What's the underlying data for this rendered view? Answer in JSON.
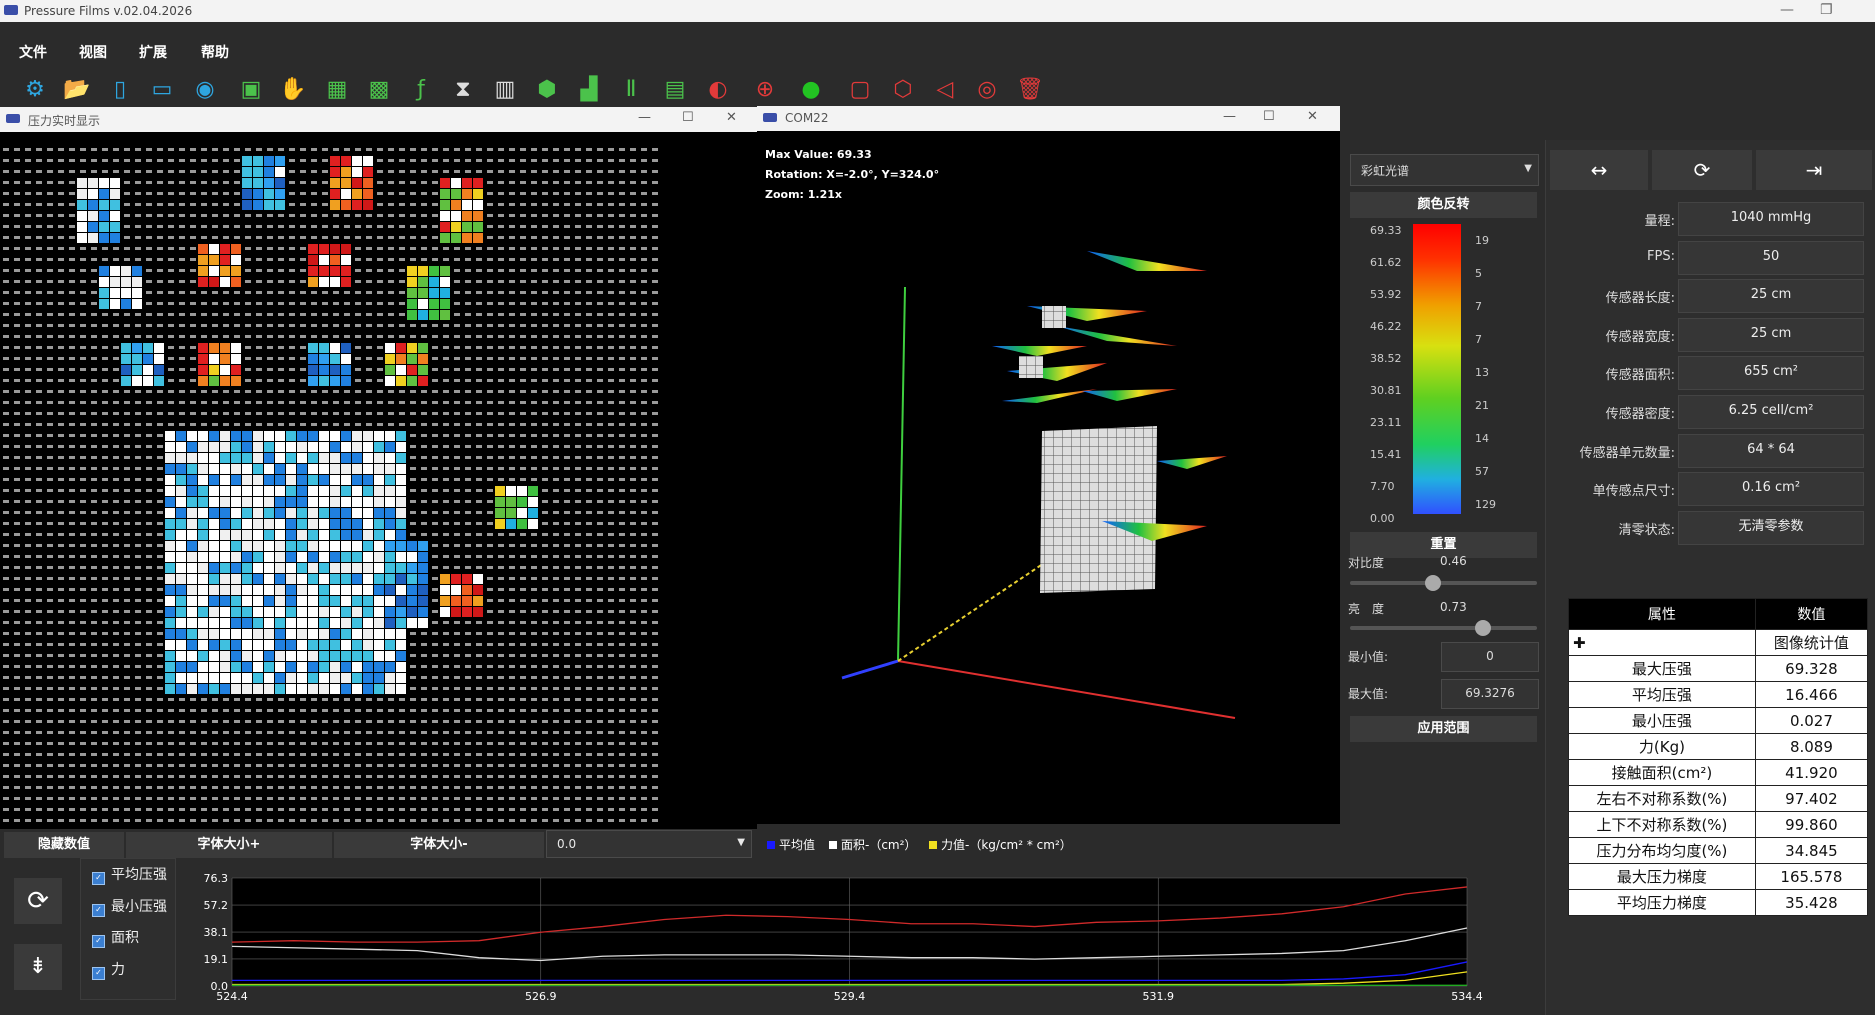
{
  "app": {
    "title": "Pressure Films v.02.04.2026"
  },
  "menu": [
    "文件",
    "视图",
    "扩展",
    "帮助"
  ],
  "toolbar": [
    {
      "icon": "tools-icon",
      "glyph": "⚙",
      "color": "#2ea6e0"
    },
    {
      "icon": "folder-open-icon",
      "glyph": "📂",
      "color": "#2ea6e0"
    },
    {
      "icon": "document-icon",
      "glyph": "▯",
      "color": "#2ea6e0"
    },
    {
      "icon": "monitor-icon",
      "glyph": "▭",
      "color": "#2ea6e0"
    },
    {
      "icon": "camera-icon",
      "glyph": "◉",
      "color": "#2ea6e0"
    },
    {
      "icon": "calibrate-icon",
      "glyph": "▣",
      "color": "#4bc24b"
    },
    {
      "icon": "hand-icon",
      "glyph": "✋",
      "color": "#4bc24b"
    },
    {
      "icon": "grid-icon",
      "glyph": "▦",
      "color": "#4bc24b"
    },
    {
      "icon": "grid-dense-icon",
      "glyph": "▩",
      "color": "#4bc24b"
    },
    {
      "icon": "function-icon",
      "glyph": "ƒ",
      "color": "#4bc24b"
    },
    {
      "icon": "hourglass-icon",
      "glyph": "⧗",
      "color": "#dddddd"
    },
    {
      "icon": "book-icon",
      "glyph": "▥",
      "color": "#dddddd"
    },
    {
      "icon": "cube-icon",
      "glyph": "⬢",
      "color": "#4bc24b"
    },
    {
      "icon": "chart-icon",
      "glyph": "▟",
      "color": "#4bc24b"
    },
    {
      "icon": "ruler-icon",
      "glyph": "Ⅱ",
      "color": "#4bc24b"
    },
    {
      "icon": "report-icon",
      "glyph": "▤",
      "color": "#4bc24b"
    },
    {
      "icon": "target-icon",
      "glyph": "◐",
      "color": "#e23a3a"
    },
    {
      "icon": "globe-icon",
      "glyph": "⊕",
      "color": "#e23a3a"
    },
    {
      "icon": "record-icon",
      "glyph": "●",
      "color": "#22c322"
    },
    {
      "icon": "crop-icon",
      "glyph": "▢",
      "color": "#e23a3a"
    },
    {
      "icon": "polygon-icon",
      "glyph": "⬡",
      "color": "#e23a3a"
    },
    {
      "icon": "lasso-icon",
      "glyph": "◁",
      "color": "#e23a3a"
    },
    {
      "icon": "eye-icon",
      "glyph": "◎",
      "color": "#e23a3a"
    },
    {
      "icon": "trash-icon",
      "glyph": "🗑",
      "color": "#e23a3a"
    }
  ],
  "heatmap_window": {
    "title": "压力实时显示"
  },
  "window3d": {
    "title": "COM22",
    "max_value": "Max Value: 69.33",
    "rotation": "Rotation: X=-2.0°, Y=324.0°",
    "zoom": "Zoom: 1.21x"
  },
  "color_panel": {
    "palette": "彩虹光谱",
    "invert_label": "颜色反转",
    "scale_ticks": [
      "69.33",
      "61.62",
      "53.92",
      "46.22",
      "38.52",
      "30.81",
      "23.11",
      "15.41",
      "7.70",
      "0.00"
    ],
    "count_ticks": [
      "19",
      "5",
      "7",
      "7",
      "13",
      "21",
      "14",
      "57",
      "129"
    ],
    "reset_label": "重置",
    "contrast_label": "对比度",
    "contrast_value": "0.46",
    "brightness_label": "亮　度",
    "brightness_value": "0.73",
    "min_label": "最小值:",
    "min_value": "0",
    "max_label": "最大值:",
    "max_value": "69.3276",
    "apply_label": "应用范围"
  },
  "params": [
    {
      "label": "量程:",
      "value": "1040 mmHg"
    },
    {
      "label": "FPS:",
      "value": "50"
    },
    {
      "label": "传感器长度:",
      "value": "25 cm"
    },
    {
      "label": "传感器宽度:",
      "value": "25 cm"
    },
    {
      "label": "传感器面积:",
      "value": "655 cm²"
    },
    {
      "label": "传感器密度:",
      "value": "6.25 cell/cm²"
    },
    {
      "label": "传感器单元数量:",
      "value": "64 * 64"
    },
    {
      "label": "单传感点尺寸:",
      "value": "0.16 cm²"
    },
    {
      "label": "清零状态:",
      "value": "无清零参数"
    }
  ],
  "stats": {
    "headers": [
      "属性",
      "数值"
    ],
    "section": "图像统计值",
    "rows": [
      [
        "最大压强",
        "69.328"
      ],
      [
        "平均压强",
        "16.466"
      ],
      [
        "最小压强",
        "0.027"
      ],
      [
        "力(Kg)",
        "8.089"
      ],
      [
        "接触面积(cm²)",
        "41.920"
      ],
      [
        "左右不对称系数(%)",
        "97.402"
      ],
      [
        "上下不对称系数(%)",
        "99.860"
      ],
      [
        "压力分布均匀度(%)",
        "34.845"
      ],
      [
        "最大压力梯度",
        "165.578"
      ],
      [
        "平均压力梯度",
        "35.428"
      ]
    ]
  },
  "bottom": {
    "hide_values": "隐藏数值",
    "font_up": "字体大小+",
    "font_down": "字体大小-",
    "value_combo": "0.0",
    "checkboxes": [
      "平均压强",
      "最小压强",
      "面积",
      "力"
    ]
  },
  "legend": {
    "avg": "平均值",
    "area": "面积-（cm²）",
    "force": "力值-（kg/cm² * cm²）",
    "colors": {
      "avg": "#1a1aff",
      "area": "#ffffff",
      "force": "#f0e020"
    }
  },
  "chart_data": {
    "type": "line",
    "x": [
      524.4,
      524.9,
      525.4,
      525.9,
      526.4,
      526.9,
      527.4,
      527.9,
      528.4,
      528.9,
      529.4,
      529.9,
      530.4,
      530.9,
      531.4,
      531.9,
      532.4,
      532.9,
      533.4,
      533.9,
      534.4
    ],
    "x_ticks": [
      "524.4",
      "526.9",
      "529.4",
      "531.9",
      "534.4"
    ],
    "y_ticks": [
      "76.3",
      "57.2",
      "38.1",
      "19.1",
      "0.0"
    ],
    "ylim": [
      0,
      76.3
    ],
    "xlim": [
      524.4,
      534.4
    ],
    "series": [
      {
        "color": "#d02a2a",
        "values": [
          31,
          32,
          31,
          31,
          32,
          38,
          42,
          47,
          50,
          49,
          47,
          44,
          44,
          42,
          45,
          46,
          48,
          51,
          56,
          65,
          70
        ]
      },
      {
        "color": "#dddddd",
        "values": [
          28,
          27,
          26,
          25,
          20,
          18,
          21,
          22,
          22,
          22,
          21,
          20,
          20,
          19,
          20,
          21,
          22,
          23,
          25,
          32,
          41
        ]
      },
      {
        "color": "#1a1aff",
        "values": [
          4,
          4,
          4,
          4,
          4,
          4,
          4,
          4,
          4,
          4,
          4,
          4,
          4,
          4,
          4,
          4,
          4,
          4,
          5,
          8,
          17
        ]
      },
      {
        "color": "#f0e020",
        "values": [
          1,
          1,
          1,
          1,
          1,
          1,
          1,
          1,
          1,
          1,
          1,
          1,
          1,
          1,
          1,
          1,
          1,
          1,
          2,
          4,
          10
        ]
      },
      {
        "color": "#22aa22",
        "values": [
          0.5,
          0.5,
          0.5,
          0.5,
          0.5,
          0.5,
          0.5,
          0.5,
          0.5,
          0.5,
          0.5,
          0.5,
          0.5,
          0.5,
          0.5,
          0.5,
          0.5,
          0.5,
          0.5,
          0.5,
          0.5
        ]
      }
    ]
  }
}
